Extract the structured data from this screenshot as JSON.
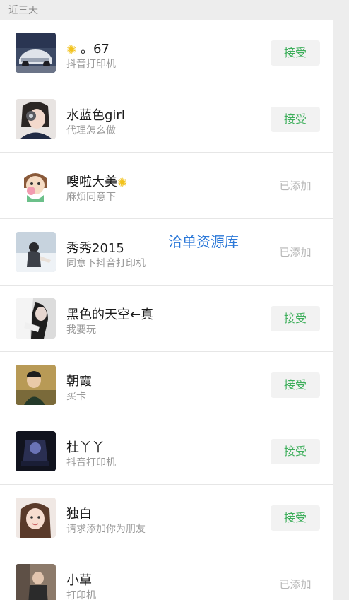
{
  "section": {
    "title": "近三天"
  },
  "watermark": "洽单资源库",
  "colors": {
    "accent_green": "#3cae5a",
    "background": "#ededed",
    "watermark_blue": "#2b78d8"
  },
  "requests": [
    {
      "name": "。67",
      "icon_prefix": "sun-icon",
      "message": "抖音打印机",
      "action": "接受",
      "state": "pending"
    },
    {
      "name": "水蓝色girl",
      "message": "代理怎么做",
      "action": "接受",
      "state": "pending"
    },
    {
      "name": "嗖啦大美",
      "icon_suffix": "sun-icon",
      "message": "麻烦同意下",
      "action": "已添加",
      "state": "added"
    },
    {
      "name": "秀秀2015",
      "message": "同意下抖音打印机",
      "action": "已添加",
      "state": "added"
    },
    {
      "name": "黑色的天空←真",
      "message": "我要玩",
      "action": "接受",
      "state": "pending"
    },
    {
      "name": "朝霞",
      "message": "买卡",
      "action": "接受",
      "state": "pending"
    },
    {
      "name": "杜丫丫",
      "message": "抖音打印机",
      "action": "接受",
      "state": "pending"
    },
    {
      "name": "独白",
      "message": "请求添加你为朋友",
      "action": "接受",
      "state": "pending"
    },
    {
      "name": "小草",
      "message": "打印机",
      "action": "已添加",
      "state": "added"
    }
  ]
}
